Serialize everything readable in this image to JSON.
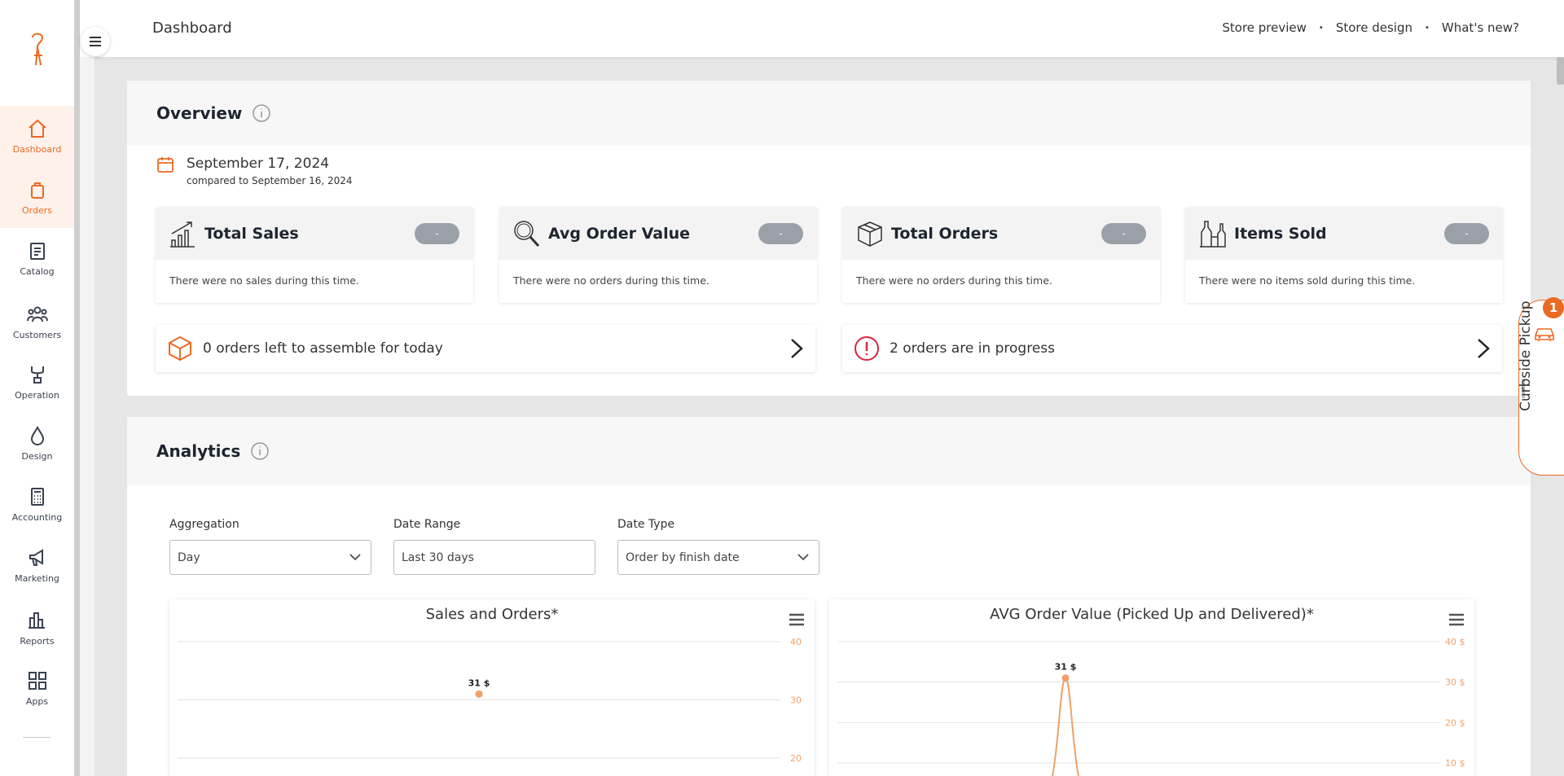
{
  "header": {
    "title": "Dashboard",
    "links": [
      "Store preview",
      "Store design",
      "What's new?"
    ],
    "separator": "•"
  },
  "sidebar": {
    "items": [
      {
        "label": "Dashboard",
        "icon": "home-icon",
        "active": true
      },
      {
        "label": "Orders",
        "icon": "shopping-bag-icon",
        "active": true
      },
      {
        "label": "Catalog",
        "icon": "clipboard-icon",
        "active": false
      },
      {
        "label": "Customers",
        "icon": "users-icon",
        "active": false
      },
      {
        "label": "Operation",
        "icon": "wrench-icon",
        "active": false
      },
      {
        "label": "Design",
        "icon": "drops-icon",
        "active": false
      },
      {
        "label": "Accounting",
        "icon": "calculator-icon",
        "active": false
      },
      {
        "label": "Marketing",
        "icon": "megaphone-icon",
        "active": false
      },
      {
        "label": "Reports",
        "icon": "bar-chart-icon",
        "active": false
      },
      {
        "label": "Apps",
        "icon": "apps-grid-icon",
        "active": false
      }
    ]
  },
  "overview": {
    "title": "Overview",
    "date": "September 17, 2024",
    "compared": "compared to September 16, 2024",
    "stats": [
      {
        "title": "Total Sales",
        "badge": "-",
        "message": "There were no sales during this time.",
        "icon": "chart-growth-icon"
      },
      {
        "title": "Avg Order Value",
        "badge": "-",
        "message": "There were no orders during this time.",
        "icon": "magnifier-icon"
      },
      {
        "title": "Total Orders",
        "badge": "-",
        "message": "There were no orders during this time.",
        "icon": "package-icon"
      },
      {
        "title": "Items Sold",
        "badge": "-",
        "message": "There were no items sold during this time.",
        "icon": "bottles-icon"
      }
    ],
    "tasks": [
      {
        "text": "0 orders left to assemble for today",
        "icon": "box-icon"
      },
      {
        "text": "2 orders are in progress",
        "icon": "alert-icon"
      }
    ]
  },
  "analytics": {
    "title": "Analytics",
    "filters": [
      {
        "label": "Aggregation",
        "value": "Day",
        "type": "select"
      },
      {
        "label": "Date Range",
        "value": "Last 30 days",
        "type": "input"
      },
      {
        "label": "Date Type",
        "value": "Order by finish date",
        "type": "select"
      }
    ]
  },
  "chart_data": [
    {
      "type": "line",
      "title": "Sales and Orders*",
      "y_ticks": [
        "40",
        "30",
        "20"
      ],
      "ylim": [
        20,
        40
      ],
      "points": [
        {
          "y": 31,
          "label": "31 $"
        }
      ],
      "color": "#f0a06a"
    },
    {
      "type": "line",
      "title": "AVG Order Value (Picked Up and Delivered)*",
      "y_ticks": [
        "40 $",
        "30 $",
        "20 $",
        "10 $"
      ],
      "ylim": [
        10,
        40
      ],
      "points": [
        {
          "y": 31,
          "label": "31 $"
        }
      ],
      "color": "#f0a06a"
    }
  ],
  "curbside": {
    "label": "Curbside Pickup",
    "count": "1"
  },
  "colors": {
    "accent": "#ea6a24",
    "alert": "#d9263a",
    "badge": "#9aa0a8"
  }
}
